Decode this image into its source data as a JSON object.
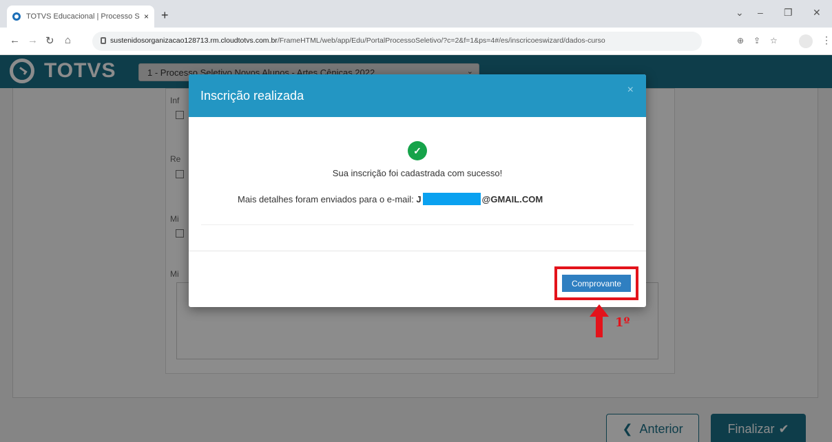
{
  "browser": {
    "tab_title": "TOTVS Educacional | Processo Se",
    "tab_close": "×",
    "new_tab": "+",
    "url_host": "sustenidosorganizacao128713.rm.cloudtotvs.com.br",
    "url_path": "/FrameHTML/web/app/Edu/PortalProcessoSeletivo/?c=2&f=1&ps=4#/es/inscricoeswizard/dados-curso",
    "controls": {
      "minimize": "–",
      "restore": "❐",
      "close": "✕",
      "chevron": "⌄"
    }
  },
  "app": {
    "logo_text": "TOTVS",
    "process_select": "1 - Processo Seletivo Novos Alunos - Artes Cênicas 2022",
    "field_labels": [
      "Inf",
      "Re",
      "Mi",
      "Mi"
    ],
    "buttons": {
      "anterior": "Anterior",
      "finalizar": "Finalizar"
    }
  },
  "modal": {
    "title": "Inscrição realizada",
    "close": "×",
    "success_message": "Sua inscrição foi cadastrada com sucesso!",
    "email_prefix": "Mais detalhes foram enviados para o e-mail:",
    "email_user": "J",
    "email_domain": "@GMAIL.COM",
    "comprovante_button": "Comprovante"
  },
  "annotation": {
    "label": "1º",
    "color": "#e3131b"
  },
  "colors": {
    "header": "#1b6f87",
    "modal_header": "#2396c3",
    "success": "#16a34a",
    "redaction": "#0aa1f0"
  }
}
